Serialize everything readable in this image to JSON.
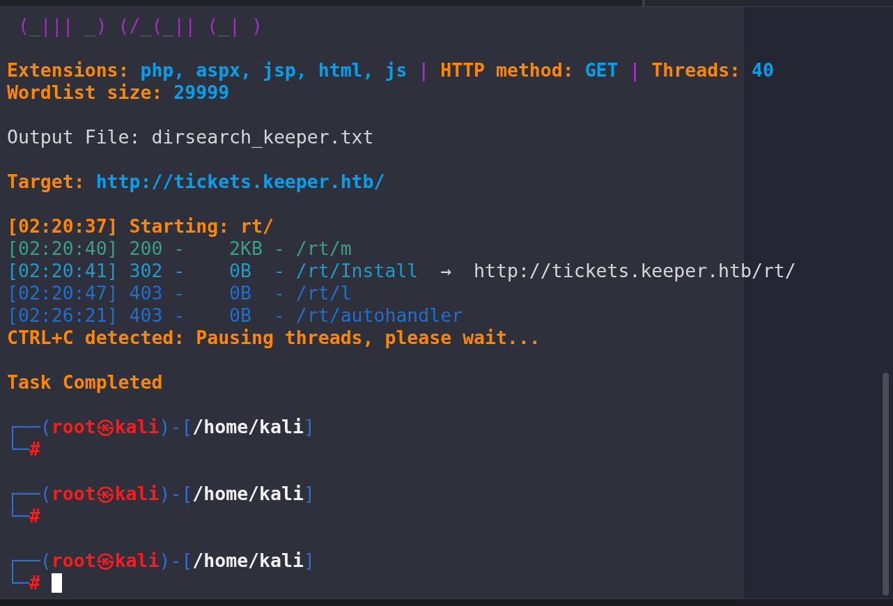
{
  "terminal": {
    "lines": [
      {
        "kind": "text",
        "segments": [
          {
            "text": " (_||| _) (/_(_|| (_| )",
            "color": "#a12fc0",
            "bold": false
          }
        ]
      },
      {
        "kind": "blank"
      },
      {
        "kind": "text",
        "segments": [
          {
            "text": "Extensions: ",
            "color": "#ff8700",
            "bold": true
          },
          {
            "text": "php, aspx, jsp, html, js",
            "color": "#00a2ef",
            "bold": true
          },
          {
            "text": " | ",
            "color": "#a12fc0",
            "bold": true
          },
          {
            "text": "HTTP method: ",
            "color": "#ff8700",
            "bold": true
          },
          {
            "text": "GET",
            "color": "#00a2ef",
            "bold": true
          },
          {
            "text": " | ",
            "color": "#a12fc0",
            "bold": true
          },
          {
            "text": "Threads: ",
            "color": "#ff8700",
            "bold": true
          },
          {
            "text": "40",
            "color": "#00a2ef",
            "bold": true
          }
        ]
      },
      {
        "kind": "text",
        "segments": [
          {
            "text": "Wordlist size: ",
            "color": "#ff8700",
            "bold": true
          },
          {
            "text": "29999",
            "color": "#00a2ef",
            "bold": true
          }
        ]
      },
      {
        "kind": "blank"
      },
      {
        "kind": "text",
        "segments": [
          {
            "text": "Output File: dirsearch_keeper.txt",
            "color": "#d6d6d6",
            "bold": false
          }
        ]
      },
      {
        "kind": "blank"
      },
      {
        "kind": "text",
        "segments": [
          {
            "text": "Target: ",
            "color": "#ff8700",
            "bold": true
          },
          {
            "text": "http://tickets.keeper.htb/",
            "color": "#00a2ef",
            "bold": true
          }
        ]
      },
      {
        "kind": "blank"
      },
      {
        "kind": "text",
        "segments": [
          {
            "text": "[02:20:37] Starting: rt/",
            "color": "#ff8700",
            "bold": true
          }
        ]
      },
      {
        "kind": "text",
        "segments": [
          {
            "text": "[02:20:40] 200 -    2KB - /rt/m",
            "color": "#3a9e87",
            "bold": false
          }
        ]
      },
      {
        "kind": "text",
        "segments": [
          {
            "text": "[02:20:41] 302 -    0B  - /rt/Install",
            "color": "#1e9bc9",
            "bold": false
          },
          {
            "text": "  →  http://tickets.keeper.htb/rt/",
            "color": "#d6d6d6",
            "bold": false
          }
        ]
      },
      {
        "kind": "text",
        "segments": [
          {
            "text": "[02:20:47] 403 -    0B  - /rt/l",
            "color": "#1f6fcf",
            "bold": false
          }
        ]
      },
      {
        "kind": "text",
        "segments": [
          {
            "text": "[02:26:21] 403 -    0B  - /rt/autohandler",
            "color": "#1f6fcf",
            "bold": false
          }
        ]
      },
      {
        "kind": "text",
        "segments": [
          {
            "text": "CTRL+C detected: Pausing threads, please wait...",
            "color": "#ff8700",
            "bold": true
          }
        ]
      },
      {
        "kind": "blank"
      },
      {
        "kind": "text",
        "segments": [
          {
            "text": "Task Completed",
            "color": "#ff8700",
            "bold": true
          }
        ]
      },
      {
        "kind": "blank"
      },
      {
        "kind": "text",
        "segments": [
          {
            "text": "┌──(",
            "color": "#2f6fd0",
            "bold": false
          },
          {
            "text": "root㉿kali",
            "color": "#ff1a1a",
            "bold": true
          },
          {
            "text": ")-[",
            "color": "#2f6fd0",
            "bold": false
          },
          {
            "text": "/home/kali",
            "color": "#f0f0f0",
            "bold": true
          },
          {
            "text": "]",
            "color": "#2f6fd0",
            "bold": false
          }
        ]
      },
      {
        "kind": "text",
        "segments": [
          {
            "text": "└─",
            "color": "#2f6fd0"
          },
          {
            "text": "#",
            "color": "#ff1a1a",
            "bold": true
          }
        ]
      },
      {
        "kind": "blank"
      },
      {
        "kind": "text",
        "segments": [
          {
            "text": "┌──(",
            "color": "#2f6fd0",
            "bold": false
          },
          {
            "text": "root㉿kali",
            "color": "#ff1a1a",
            "bold": true
          },
          {
            "text": ")-[",
            "color": "#2f6fd0",
            "bold": false
          },
          {
            "text": "/home/kali",
            "color": "#f0f0f0",
            "bold": true
          },
          {
            "text": "]",
            "color": "#2f6fd0",
            "bold": false
          }
        ]
      },
      {
        "kind": "text",
        "segments": [
          {
            "text": "└─",
            "color": "#2f6fd0"
          },
          {
            "text": "#",
            "color": "#ff1a1a",
            "bold": true
          }
        ]
      },
      {
        "kind": "blank"
      },
      {
        "kind": "text",
        "segments": [
          {
            "text": "┌──(",
            "color": "#2f6fd0",
            "bold": false
          },
          {
            "text": "root㉿kali",
            "color": "#ff1a1a",
            "bold": true
          },
          {
            "text": ")-[",
            "color": "#2f6fd0",
            "bold": false
          },
          {
            "text": "/home/kali",
            "color": "#f0f0f0",
            "bold": true
          },
          {
            "text": "]",
            "color": "#2f6fd0",
            "bold": false
          }
        ]
      },
      {
        "kind": "text",
        "cursor": true,
        "segments": [
          {
            "text": "└─",
            "color": "#2f6fd0"
          },
          {
            "text": "#",
            "color": "#ff1a1a",
            "bold": true
          }
        ]
      }
    ]
  }
}
